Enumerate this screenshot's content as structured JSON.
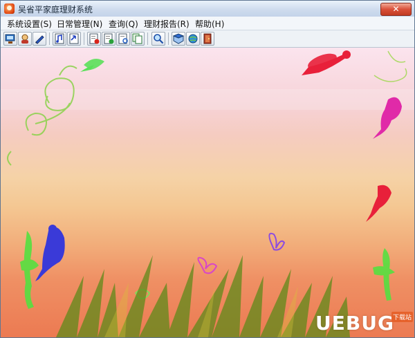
{
  "window": {
    "title": "吴省平家庭理财系统",
    "close_label": "✕"
  },
  "menubar": {
    "items": [
      {
        "label": "系统设置(S)"
      },
      {
        "label": "日常管理(N)"
      },
      {
        "label": "查询(Q)"
      },
      {
        "label": "理财报告(R)"
      },
      {
        "label": "帮助(H)"
      }
    ]
  },
  "toolbar": {
    "buttons": [
      {
        "icon": "computer-settings-icon"
      },
      {
        "icon": "user-icon"
      },
      {
        "icon": "edit-pen-icon"
      },
      {
        "icon": "music-note-icon"
      },
      {
        "icon": "note-arrow-icon"
      },
      {
        "icon": "record-red-icon"
      },
      {
        "icon": "record-green-icon"
      },
      {
        "icon": "record-view-icon"
      },
      {
        "icon": "record-copy-icon"
      },
      {
        "icon": "search-icon"
      },
      {
        "icon": "book-icon"
      },
      {
        "icon": "globe-tool-icon"
      },
      {
        "icon": "exit-door-icon"
      }
    ]
  },
  "watermark": {
    "text": "UEBUG",
    "badge": "下载站"
  },
  "colors": {
    "titlebar": "#cfdcee",
    "close_button": "#d9503a",
    "background_top": "#fbe4ee",
    "background_bottom": "#ec7a52",
    "fairy_red": "#e8203a",
    "fairy_magenta": "#e02aa8",
    "fairy_blue": "#3a3ad8",
    "fairy_green": "#55e040",
    "grass": "#5f8a1a"
  }
}
